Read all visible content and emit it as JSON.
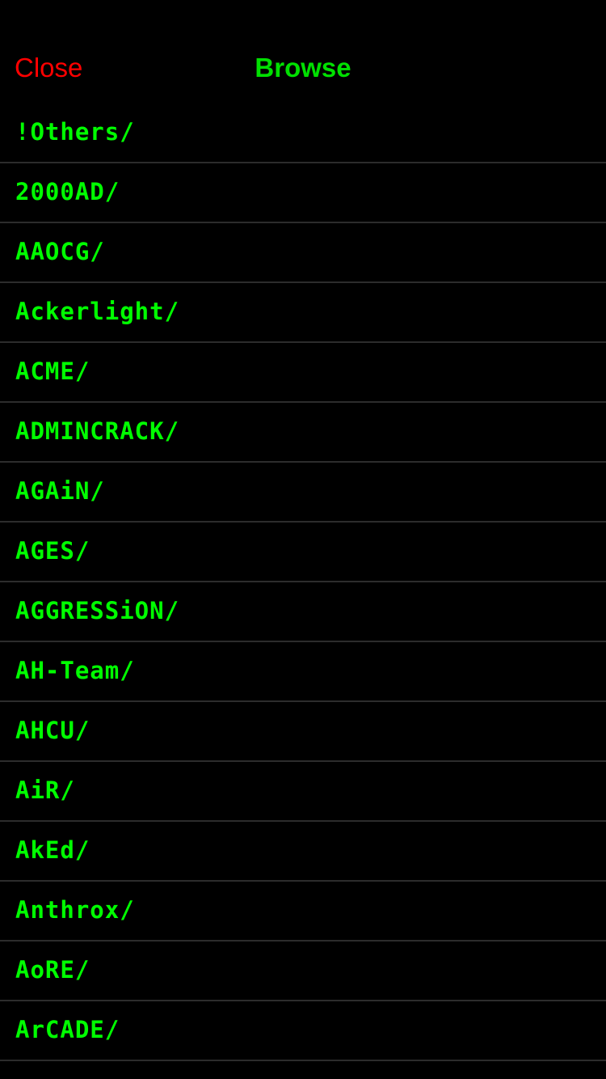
{
  "nav": {
    "close_label": "Close",
    "title": "Browse"
  },
  "colors": {
    "background": "#000000",
    "close": "#ff0000",
    "title": "#00e000",
    "item_text": "#00ff00",
    "separator": "#2c2c2c"
  },
  "folders": [
    {
      "label": "!Others/"
    },
    {
      "label": "2000AD/"
    },
    {
      "label": "AAOCG/"
    },
    {
      "label": "Ackerlight/"
    },
    {
      "label": "ACME/"
    },
    {
      "label": "ADMINCRACK/"
    },
    {
      "label": "AGAiN/"
    },
    {
      "label": "AGES/"
    },
    {
      "label": "AGGRESSiON/"
    },
    {
      "label": "AH-Team/"
    },
    {
      "label": "AHCU/"
    },
    {
      "label": "AiR/"
    },
    {
      "label": "AkEd/"
    },
    {
      "label": "Anthrox/"
    },
    {
      "label": "AoRE/"
    },
    {
      "label": "ArCADE/"
    }
  ]
}
